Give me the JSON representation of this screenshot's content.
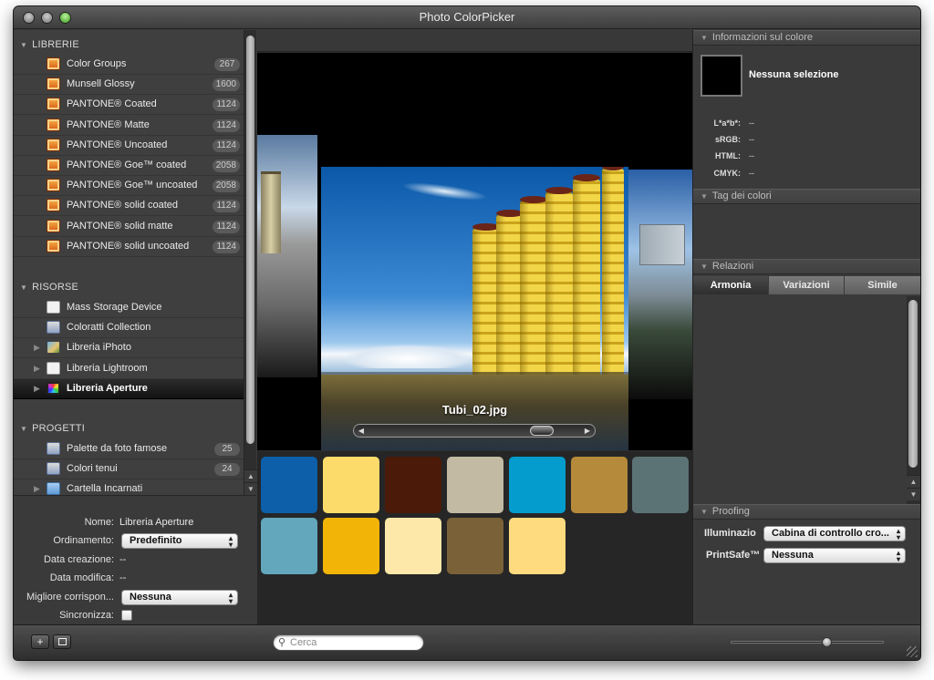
{
  "window": {
    "title": "Photo ColorPicker"
  },
  "libraries": {
    "header": "LIBRERIE",
    "items": [
      {
        "label": "Color Groups",
        "count": "267"
      },
      {
        "label": "Munsell Glossy",
        "count": "1600"
      },
      {
        "label": "PANTONE® Coated",
        "count": "1124"
      },
      {
        "label": "PANTONE® Matte",
        "count": "1124"
      },
      {
        "label": "PANTONE® Uncoated",
        "count": "1124"
      },
      {
        "label": "PANTONE® Goe™ coated",
        "count": "2058"
      },
      {
        "label": "PANTONE® Goe™ uncoated",
        "count": "2058"
      },
      {
        "label": "PANTONE® solid coated",
        "count": "1124"
      },
      {
        "label": "PANTONE® solid matte",
        "count": "1124"
      },
      {
        "label": "PANTONE® solid uncoated",
        "count": "1124"
      }
    ]
  },
  "resources": {
    "header": "RISORSE",
    "items": [
      {
        "label": "Mass Storage Device",
        "icon": "document-icon"
      },
      {
        "label": "Coloratti Collection",
        "icon": "collection-icon"
      },
      {
        "label": "Libreria iPhoto",
        "icon": "iphoto-icon"
      },
      {
        "label": "Libreria Lightroom",
        "icon": "document-icon"
      },
      {
        "label": "Libreria Aperture",
        "icon": "aperture-icon",
        "selected": true
      }
    ]
  },
  "projects": {
    "header": "PROGETTI",
    "items": [
      {
        "label": "Palette da foto famose",
        "count": "25"
      },
      {
        "label": "Colori tenui",
        "count": "24"
      },
      {
        "label": "Cartella Incarnati"
      }
    ]
  },
  "properties": {
    "name_label": "Nome:",
    "name_value": "Libreria Aperture",
    "sort_label": "Ordinamento:",
    "sort_value": "Predefinito",
    "created_label": "Data creazione:",
    "created_value": "--",
    "modified_label": "Data modifica:",
    "modified_value": "--",
    "best_match_label": "Migliore corrispon...",
    "best_match_value": "Nessuna",
    "sync_label": "Sincronizza:"
  },
  "viewer": {
    "caption": "Tubi_02.jpg",
    "scroll_position": 0.85
  },
  "swatches": [
    "#0c5fa8",
    "#fddb6b",
    "#4b1a08",
    "#c2baa3",
    "#049ccd",
    "#b58a3a",
    "#5c7375",
    "#62a7bc",
    "#f2b407",
    "#fde8a9",
    "#7b6137",
    "#fedb7e"
  ],
  "color_info": {
    "header": "Informazioni sul colore",
    "no_selection": "Nessuna selezione",
    "lab_label": "L*a*b*:",
    "lab_value": "--",
    "srgb_label": "sRGB:",
    "srgb_value": "--",
    "html_label": "HTML:",
    "html_value": "--",
    "cmyk_label": "CMYK:",
    "cmyk_value": "--"
  },
  "color_tags": {
    "header": "Tag dei colori"
  },
  "relations": {
    "header": "Relazioni",
    "tabs": [
      {
        "label": "Armonia"
      },
      {
        "label": "Variazioni"
      },
      {
        "label": "Simile"
      }
    ]
  },
  "proofing": {
    "header": "Proofing",
    "illum_label": "Illuminazio",
    "illum_value": "Cabina di controllo cro...",
    "printsafe_label": "PrintSafe™",
    "printsafe_value": "Nessuna"
  },
  "bottom": {
    "add_label": "+",
    "search_placeholder": "Cerca",
    "zoom_level": 0.62
  }
}
